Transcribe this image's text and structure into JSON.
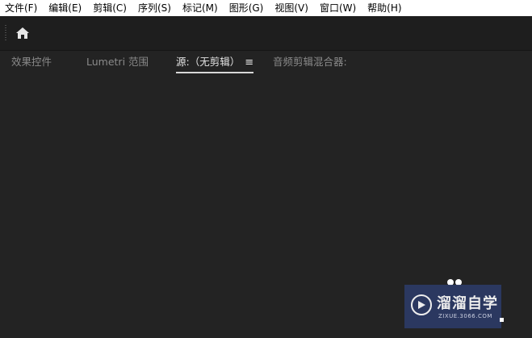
{
  "menubar": {
    "items": [
      "文件(F)",
      "编辑(E)",
      "剪辑(C)",
      "序列(S)",
      "标记(M)",
      "图形(G)",
      "视图(V)",
      "窗口(W)",
      "帮助(H)"
    ]
  },
  "toolbar": {
    "home_icon": "home-icon"
  },
  "panel": {
    "tabs": [
      {
        "label": "效果控件"
      },
      {
        "label": "Lumetri 范围"
      },
      {
        "label": "源:（无剪辑）",
        "menu": "≡"
      },
      {
        "label": "音频剪辑混合器:"
      }
    ],
    "active_tab": 2
  },
  "watermark": {
    "title": "溜溜自学",
    "url": "ZIXUE.3066.COM"
  },
  "colors": {
    "menubar_bg": "#ffffff",
    "toolbar_bg": "#1e1e1e",
    "panel_bg": "#232323",
    "tab_inactive": "#8a8a8a",
    "tab_active": "#e4e4e4",
    "watermark_bg": "#2c3a66"
  }
}
